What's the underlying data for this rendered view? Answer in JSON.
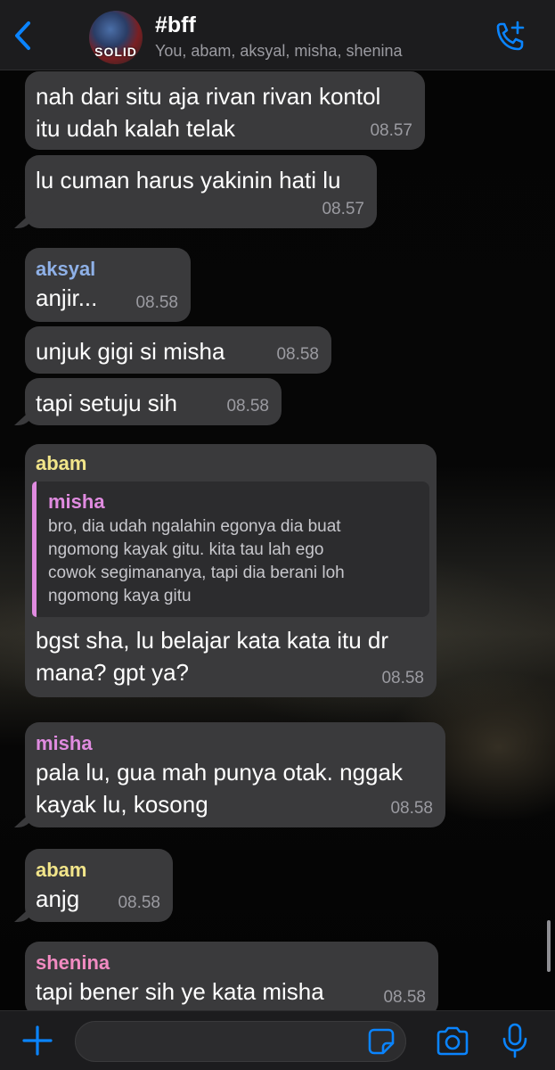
{
  "header": {
    "title": "#bff",
    "subtitle": "You, abam, aksyal, misha, shenina",
    "avatar_text": "SOLID",
    "back_icon": "chevron-left-icon",
    "call_icon": "add-call-icon",
    "accent_color": "#0a84ff"
  },
  "messages": [
    {
      "text": "nah dari situ aja rivan rivan kontol\nitu udah kalah telak",
      "time": "08.57"
    },
    {
      "text": "lu cuman harus yakinin hati lu",
      "time": "08.57"
    },
    {
      "sender": "aksyal",
      "sender_color": "#8fb1e8",
      "text": "anjir...",
      "time": "08.58"
    },
    {
      "text": "unjuk gigi si misha",
      "time": "08.58"
    },
    {
      "text": "tapi setuju sih",
      "time": "08.58"
    },
    {
      "sender": "abam",
      "sender_color": "#f2e58a",
      "quote": {
        "sender": "misha",
        "sender_color": "#e08be0",
        "text": "bro, dia udah ngalahin egonya dia buat\nngomong kayak gitu. kita tau lah ego\ncowok segimananya, tapi dia berani loh\nngomong kaya gitu"
      },
      "text": "bgst sha, lu belajar kata kata itu dr\nmana? gpt ya?",
      "time": "08.58"
    },
    {
      "sender": "misha",
      "sender_color": "#e08be0",
      "text": "pala lu, gua mah punya otak. nggak\nkayak lu, kosong",
      "time": "08.58"
    },
    {
      "sender": "abam",
      "sender_color": "#f2e58a",
      "text": "anjg",
      "time": "08.58"
    },
    {
      "sender": "shenina",
      "sender_color": "#f28bc2",
      "text": "tapi bener sih ye kata misha",
      "time": "08.58"
    }
  ],
  "input": {
    "placeholder": "",
    "plus_icon": "plus-icon",
    "sticker_icon": "sticker-icon",
    "camera_icon": "camera-icon",
    "mic_icon": "microphone-icon"
  }
}
